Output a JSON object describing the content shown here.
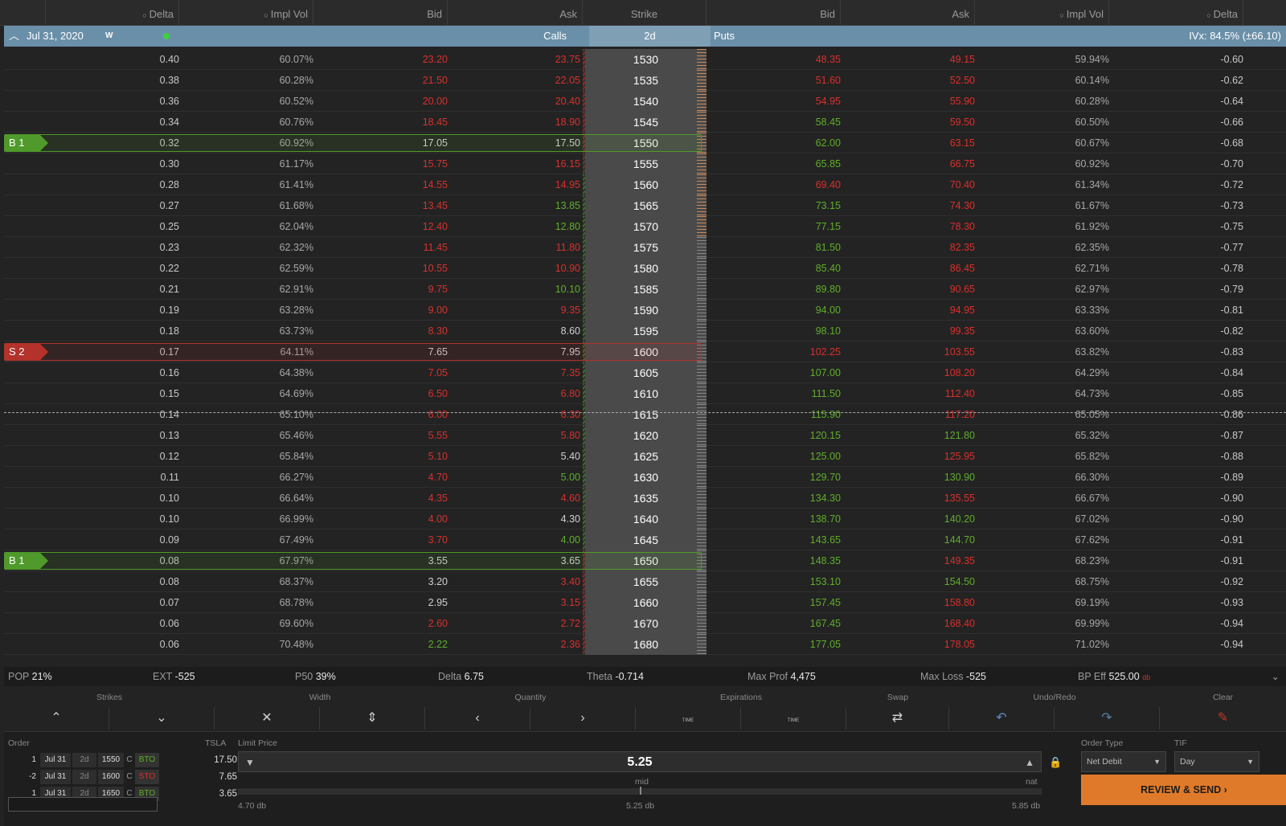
{
  "header": {
    "cols": {
      "call_delta": "Delta",
      "call_iv": "Impl Vol",
      "call_bid": "Bid",
      "call_ask": "Ask",
      "strike": "Strike",
      "put_bid": "Bid",
      "put_ask": "Ask",
      "put_iv": "Impl Vol",
      "put_delta": "Delta"
    }
  },
  "expiration": {
    "date": "Jul 31, 2020",
    "cycle": "W",
    "calls": "Calls",
    "dte": "2d",
    "puts": "Puts",
    "ivx": "IVx: 84.5% (±66.10)"
  },
  "rows": [
    {
      "cd": "0.40",
      "civ": "60.07%",
      "cb": "23.20",
      "cbc": "red",
      "ca": "23.75",
      "cac": "red",
      "k": "1530",
      "pb": "48.35",
      "pbc": "red",
      "pa": "49.15",
      "pac": "red",
      "piv": "59.94%",
      "pd": "-0.60",
      "bar": "red"
    },
    {
      "cd": "0.38",
      "civ": "60.28%",
      "cb": "21.50",
      "cbc": "red",
      "ca": "22.05",
      "cac": "red",
      "k": "1535",
      "pb": "51.60",
      "pbc": "red",
      "pa": "52.50",
      "pac": "red",
      "piv": "60.14%",
      "pd": "-0.62",
      "bar": "red"
    },
    {
      "cd": "0.36",
      "civ": "60.52%",
      "cb": "20.00",
      "cbc": "red",
      "ca": "20.40",
      "cac": "red",
      "k": "1540",
      "pb": "54.95",
      "pbc": "red",
      "pa": "55.90",
      "pac": "red",
      "piv": "60.28%",
      "pd": "-0.64",
      "bar": "red"
    },
    {
      "cd": "0.34",
      "civ": "60.76%",
      "cb": "18.45",
      "cbc": "red",
      "ca": "18.90",
      "cac": "red",
      "k": "1545",
      "pb": "58.45",
      "pbc": "green",
      "pa": "59.50",
      "pac": "red",
      "piv": "60.50%",
      "pd": "-0.66",
      "bar": "red"
    },
    {
      "cd": "0.32",
      "civ": "60.92%",
      "cb": "17.05",
      "cbc": "white",
      "ca": "17.50",
      "cac": "white",
      "k": "1550",
      "pb": "62.00",
      "pbc": "green",
      "pa": "63.15",
      "pac": "red",
      "piv": "60.67%",
      "pd": "-0.68",
      "bar": "red",
      "leg": "B 1",
      "legc": "green"
    },
    {
      "cd": "0.30",
      "civ": "61.17%",
      "cb": "15.75",
      "cbc": "red",
      "ca": "16.15",
      "cac": "red",
      "k": "1555",
      "pb": "65.85",
      "pbc": "green",
      "pa": "66.75",
      "pac": "red",
      "piv": "60.92%",
      "pd": "-0.70",
      "bar": "mix"
    },
    {
      "cd": "0.28",
      "civ": "61.41%",
      "cb": "14.55",
      "cbc": "red",
      "ca": "14.95",
      "cac": "red",
      "k": "1560",
      "pb": "69.40",
      "pbc": "red",
      "pa": "70.40",
      "pac": "red",
      "piv": "61.34%",
      "pd": "-0.72",
      "bar": "green"
    },
    {
      "cd": "0.27",
      "civ": "61.68%",
      "cb": "13.45",
      "cbc": "red",
      "ca": "13.85",
      "cac": "green",
      "k": "1565",
      "pb": "73.15",
      "pbc": "green",
      "pa": "74.30",
      "pac": "red",
      "piv": "61.67%",
      "pd": "-0.73",
      "bar": "green"
    },
    {
      "cd": "0.25",
      "civ": "62.04%",
      "cb": "12.40",
      "cbc": "red",
      "ca": "12.80",
      "cac": "green",
      "k": "1570",
      "pb": "77.15",
      "pbc": "green",
      "pa": "78.30",
      "pac": "red",
      "piv": "61.92%",
      "pd": "-0.75",
      "bar": "green"
    },
    {
      "cd": "0.23",
      "civ": "62.32%",
      "cb": "11.45",
      "cbc": "red",
      "ca": "11.80",
      "cac": "red",
      "k": "1575",
      "pb": "81.50",
      "pbc": "green",
      "pa": "82.35",
      "pac": "red",
      "piv": "62.35%",
      "pd": "-0.77",
      "bar": "green"
    },
    {
      "cd": "0.22",
      "civ": "62.59%",
      "cb": "10.55",
      "cbc": "red",
      "ca": "10.90",
      "cac": "red",
      "k": "1580",
      "pb": "85.40",
      "pbc": "green",
      "pa": "86.45",
      "pac": "red",
      "piv": "62.71%",
      "pd": "-0.78",
      "bar": "green"
    },
    {
      "cd": "0.21",
      "civ": "62.91%",
      "cb": "9.75",
      "cbc": "red",
      "ca": "10.10",
      "cac": "green",
      "k": "1585",
      "pb": "89.80",
      "pbc": "green",
      "pa": "90.65",
      "pac": "red",
      "piv": "62.97%",
      "pd": "-0.79",
      "bar": "green"
    },
    {
      "cd": "0.19",
      "civ": "63.28%",
      "cb": "9.00",
      "cbc": "red",
      "ca": "9.35",
      "cac": "red",
      "k": "1590",
      "pb": "94.00",
      "pbc": "green",
      "pa": "94.95",
      "pac": "red",
      "piv": "63.33%",
      "pd": "-0.81",
      "bar": "green"
    },
    {
      "cd": "0.18",
      "civ": "63.73%",
      "cb": "8.30",
      "cbc": "red",
      "ca": "8.60",
      "cac": "white",
      "k": "1595",
      "pb": "98.10",
      "pbc": "green",
      "pa": "99.35",
      "pac": "red",
      "piv": "63.60%",
      "pd": "-0.82",
      "bar": "green"
    },
    {
      "cd": "0.17",
      "civ": "64.11%",
      "cb": "7.65",
      "cbc": "white",
      "ca": "7.95",
      "cac": "white",
      "k": "1600",
      "pb": "102.25",
      "pbc": "red",
      "pa": "103.55",
      "pac": "red",
      "piv": "63.82%",
      "pd": "-0.83",
      "bar": "green",
      "leg": "S 2",
      "legc": "red"
    },
    {
      "cd": "0.16",
      "civ": "64.38%",
      "cb": "7.05",
      "cbc": "red",
      "ca": "7.35",
      "cac": "red",
      "k": "1605",
      "pb": "107.00",
      "pbc": "green",
      "pa": "108.20",
      "pac": "red",
      "piv": "64.29%",
      "pd": "-0.84",
      "bar": "green"
    },
    {
      "cd": "0.15",
      "civ": "64.69%",
      "cb": "6.50",
      "cbc": "red",
      "ca": "6.80",
      "cac": "red",
      "k": "1610",
      "pb": "111.50",
      "pbc": "green",
      "pa": "112.40",
      "pac": "red",
      "piv": "64.73%",
      "pd": "-0.85",
      "bar": "green"
    },
    {
      "cd": "0.14",
      "civ": "65.10%",
      "cb": "6.00",
      "cbc": "red",
      "ca": "6.30",
      "cac": "red",
      "k": "1615",
      "pb": "115.90",
      "pbc": "green",
      "pa": "117.20",
      "pac": "red",
      "piv": "65.05%",
      "pd": "-0.86",
      "bar": "green"
    },
    {
      "cd": "0.13",
      "civ": "65.46%",
      "cb": "5.55",
      "cbc": "red",
      "ca": "5.80",
      "cac": "red",
      "k": "1620",
      "pb": "120.15",
      "pbc": "green",
      "pa": "121.80",
      "pac": "green",
      "piv": "65.32%",
      "pd": "-0.87",
      "bar": "green"
    },
    {
      "cd": "0.12",
      "civ": "65.84%",
      "cb": "5.10",
      "cbc": "red",
      "ca": "5.40",
      "cac": "white",
      "k": "1625",
      "pb": "125.00",
      "pbc": "green",
      "pa": "125.95",
      "pac": "red",
      "piv": "65.82%",
      "pd": "-0.88",
      "bar": "green"
    },
    {
      "cd": "0.11",
      "civ": "66.27%",
      "cb": "4.70",
      "cbc": "red",
      "ca": "5.00",
      "cac": "green",
      "k": "1630",
      "pb": "129.70",
      "pbc": "green",
      "pa": "130.90",
      "pac": "green",
      "piv": "66.30%",
      "pd": "-0.89",
      "bar": "green"
    },
    {
      "cd": "0.10",
      "civ": "66.64%",
      "cb": "4.35",
      "cbc": "red",
      "ca": "4.60",
      "cac": "red",
      "k": "1635",
      "pb": "134.30",
      "pbc": "green",
      "pa": "135.55",
      "pac": "red",
      "piv": "66.67%",
      "pd": "-0.90",
      "bar": "green"
    },
    {
      "cd": "0.10",
      "civ": "66.99%",
      "cb": "4.00",
      "cbc": "red",
      "ca": "4.30",
      "cac": "white",
      "k": "1640",
      "pb": "138.70",
      "pbc": "green",
      "pa": "140.20",
      "pac": "green",
      "piv": "67.02%",
      "pd": "-0.90",
      "bar": "green"
    },
    {
      "cd": "0.09",
      "civ": "67.49%",
      "cb": "3.70",
      "cbc": "red",
      "ca": "4.00",
      "cac": "green",
      "k": "1645",
      "pb": "143.65",
      "pbc": "green",
      "pa": "144.70",
      "pac": "green",
      "piv": "67.62%",
      "pd": "-0.91",
      "bar": "green"
    },
    {
      "cd": "0.08",
      "civ": "67.97%",
      "cb": "3.55",
      "cbc": "white",
      "ca": "3.65",
      "cac": "white",
      "k": "1650",
      "pb": "148.35",
      "pbc": "green",
      "pa": "149.35",
      "pac": "red",
      "piv": "68.23%",
      "pd": "-0.91",
      "bar": "red",
      "leg": "B 1",
      "legc": "green"
    },
    {
      "cd": "0.08",
      "civ": "68.37%",
      "cb": "3.20",
      "cbc": "white",
      "ca": "3.40",
      "cac": "red",
      "k": "1655",
      "pb": "153.10",
      "pbc": "green",
      "pa": "154.50",
      "pac": "green",
      "piv": "68.75%",
      "pd": "-0.92",
      "bar": "red"
    },
    {
      "cd": "0.07",
      "civ": "68.78%",
      "cb": "2.95",
      "cbc": "white",
      "ca": "3.15",
      "cac": "red",
      "k": "1660",
      "pb": "157.45",
      "pbc": "green",
      "pa": "158.80",
      "pac": "red",
      "piv": "69.19%",
      "pd": "-0.93",
      "bar": "red"
    },
    {
      "cd": "0.06",
      "civ": "69.60%",
      "cb": "2.60",
      "cbc": "red",
      "ca": "2.72",
      "cac": "red",
      "k": "1670",
      "pb": "167.45",
      "pbc": "green",
      "pa": "168.40",
      "pac": "red",
      "piv": "69.99%",
      "pd": "-0.94",
      "bar": "red"
    },
    {
      "cd": "0.06",
      "civ": "70.48%",
      "cb": "2.22",
      "cbc": "green",
      "ca": "2.36",
      "cac": "red",
      "k": "1680",
      "pb": "177.05",
      "pbc": "green",
      "pa": "178.05",
      "pac": "red",
      "piv": "71.02%",
      "pd": "-0.94",
      "bar": "red"
    }
  ],
  "stats": {
    "pop_l": "POP",
    "pop": "21%",
    "ext_l": "EXT",
    "ext": "-525",
    "p50_l": "P50",
    "p50": "39%",
    "delta_l": "Delta",
    "delta": "6.75",
    "theta_l": "Theta",
    "theta": "-0.714",
    "maxp_l": "Max Prof",
    "maxp": "4,475",
    "maxl_l": "Max Loss",
    "maxl": "-525",
    "bp_l": "BP Eff",
    "bp": "525.00",
    "bp_s": "db"
  },
  "tools": {
    "strikes": "Strikes",
    "width": "Width",
    "quantity": "Quantity",
    "expirations": "Expirations",
    "swap": "Swap",
    "undo": "Undo/Redo",
    "clear": "Clear",
    "time": "TIME"
  },
  "order": {
    "label": "Order",
    "symbol": "TSLA",
    "limit_label": "Limit Price",
    "price": "5.25",
    "type_label": "Order Type",
    "type": "Net Debit",
    "tif_label": "TIF",
    "tif": "Day",
    "mid": "mid",
    "nat": "nat",
    "min": "4.70 db",
    "mid_v": "5.25 db",
    "max": "5.85 db",
    "send": "REVIEW & SEND",
    "legs": [
      {
        "q": "1",
        "e": "Jul 31",
        "n": "2d",
        "s": "1550",
        "t": "C",
        "a": "BTO",
        "ac": "green",
        "px": "17.50"
      },
      {
        "q": "-2",
        "e": "Jul 31",
        "n": "2d",
        "s": "1600",
        "t": "C",
        "a": "STO",
        "ac": "red",
        "px": "7.65"
      },
      {
        "q": "1",
        "e": "Jul 31",
        "n": "2d",
        "s": "1650",
        "t": "C",
        "a": "BTO",
        "ac": "green",
        "px": "3.65"
      }
    ]
  },
  "colors": {
    "red": "#d9302c",
    "green": "#5fae2a",
    "accent": "#e07a2b",
    "header_blue": "#6a8fa8"
  }
}
